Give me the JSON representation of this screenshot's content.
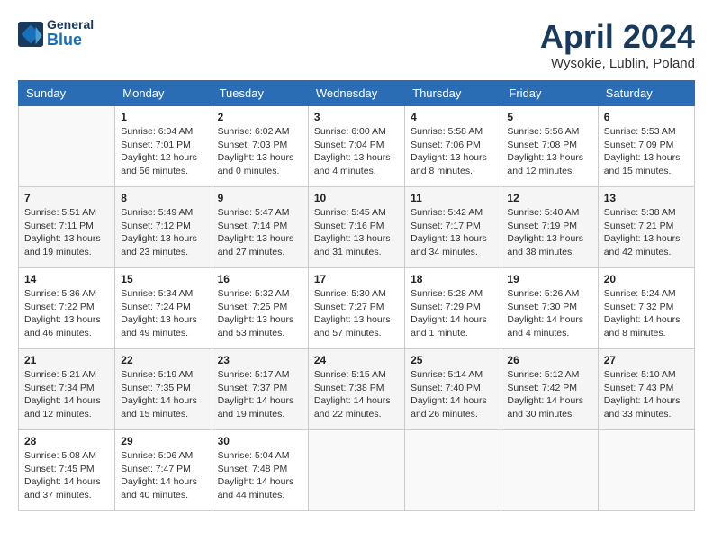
{
  "header": {
    "logo_general": "General",
    "logo_blue": "Blue",
    "month_title": "April 2024",
    "location": "Wysokie, Lublin, Poland"
  },
  "days_of_week": [
    "Sunday",
    "Monday",
    "Tuesday",
    "Wednesday",
    "Thursday",
    "Friday",
    "Saturday"
  ],
  "weeks": [
    [
      {
        "day": "",
        "info": ""
      },
      {
        "day": "1",
        "info": "Sunrise: 6:04 AM\nSunset: 7:01 PM\nDaylight: 12 hours\nand 56 minutes."
      },
      {
        "day": "2",
        "info": "Sunrise: 6:02 AM\nSunset: 7:03 PM\nDaylight: 13 hours\nand 0 minutes."
      },
      {
        "day": "3",
        "info": "Sunrise: 6:00 AM\nSunset: 7:04 PM\nDaylight: 13 hours\nand 4 minutes."
      },
      {
        "day": "4",
        "info": "Sunrise: 5:58 AM\nSunset: 7:06 PM\nDaylight: 13 hours\nand 8 minutes."
      },
      {
        "day": "5",
        "info": "Sunrise: 5:56 AM\nSunset: 7:08 PM\nDaylight: 13 hours\nand 12 minutes."
      },
      {
        "day": "6",
        "info": "Sunrise: 5:53 AM\nSunset: 7:09 PM\nDaylight: 13 hours\nand 15 minutes."
      }
    ],
    [
      {
        "day": "7",
        "info": "Sunrise: 5:51 AM\nSunset: 7:11 PM\nDaylight: 13 hours\nand 19 minutes."
      },
      {
        "day": "8",
        "info": "Sunrise: 5:49 AM\nSunset: 7:12 PM\nDaylight: 13 hours\nand 23 minutes."
      },
      {
        "day": "9",
        "info": "Sunrise: 5:47 AM\nSunset: 7:14 PM\nDaylight: 13 hours\nand 27 minutes."
      },
      {
        "day": "10",
        "info": "Sunrise: 5:45 AM\nSunset: 7:16 PM\nDaylight: 13 hours\nand 31 minutes."
      },
      {
        "day": "11",
        "info": "Sunrise: 5:42 AM\nSunset: 7:17 PM\nDaylight: 13 hours\nand 34 minutes."
      },
      {
        "day": "12",
        "info": "Sunrise: 5:40 AM\nSunset: 7:19 PM\nDaylight: 13 hours\nand 38 minutes."
      },
      {
        "day": "13",
        "info": "Sunrise: 5:38 AM\nSunset: 7:21 PM\nDaylight: 13 hours\nand 42 minutes."
      }
    ],
    [
      {
        "day": "14",
        "info": "Sunrise: 5:36 AM\nSunset: 7:22 PM\nDaylight: 13 hours\nand 46 minutes."
      },
      {
        "day": "15",
        "info": "Sunrise: 5:34 AM\nSunset: 7:24 PM\nDaylight: 13 hours\nand 49 minutes."
      },
      {
        "day": "16",
        "info": "Sunrise: 5:32 AM\nSunset: 7:25 PM\nDaylight: 13 hours\nand 53 minutes."
      },
      {
        "day": "17",
        "info": "Sunrise: 5:30 AM\nSunset: 7:27 PM\nDaylight: 13 hours\nand 57 minutes."
      },
      {
        "day": "18",
        "info": "Sunrise: 5:28 AM\nSunset: 7:29 PM\nDaylight: 14 hours\nand 1 minute."
      },
      {
        "day": "19",
        "info": "Sunrise: 5:26 AM\nSunset: 7:30 PM\nDaylight: 14 hours\nand 4 minutes."
      },
      {
        "day": "20",
        "info": "Sunrise: 5:24 AM\nSunset: 7:32 PM\nDaylight: 14 hours\nand 8 minutes."
      }
    ],
    [
      {
        "day": "21",
        "info": "Sunrise: 5:21 AM\nSunset: 7:34 PM\nDaylight: 14 hours\nand 12 minutes."
      },
      {
        "day": "22",
        "info": "Sunrise: 5:19 AM\nSunset: 7:35 PM\nDaylight: 14 hours\nand 15 minutes."
      },
      {
        "day": "23",
        "info": "Sunrise: 5:17 AM\nSunset: 7:37 PM\nDaylight: 14 hours\nand 19 minutes."
      },
      {
        "day": "24",
        "info": "Sunrise: 5:15 AM\nSunset: 7:38 PM\nDaylight: 14 hours\nand 22 minutes."
      },
      {
        "day": "25",
        "info": "Sunrise: 5:14 AM\nSunset: 7:40 PM\nDaylight: 14 hours\nand 26 minutes."
      },
      {
        "day": "26",
        "info": "Sunrise: 5:12 AM\nSunset: 7:42 PM\nDaylight: 14 hours\nand 30 minutes."
      },
      {
        "day": "27",
        "info": "Sunrise: 5:10 AM\nSunset: 7:43 PM\nDaylight: 14 hours\nand 33 minutes."
      }
    ],
    [
      {
        "day": "28",
        "info": "Sunrise: 5:08 AM\nSunset: 7:45 PM\nDaylight: 14 hours\nand 37 minutes."
      },
      {
        "day": "29",
        "info": "Sunrise: 5:06 AM\nSunset: 7:47 PM\nDaylight: 14 hours\nand 40 minutes."
      },
      {
        "day": "30",
        "info": "Sunrise: 5:04 AM\nSunset: 7:48 PM\nDaylight: 14 hours\nand 44 minutes."
      },
      {
        "day": "",
        "info": ""
      },
      {
        "day": "",
        "info": ""
      },
      {
        "day": "",
        "info": ""
      },
      {
        "day": "",
        "info": ""
      }
    ]
  ]
}
